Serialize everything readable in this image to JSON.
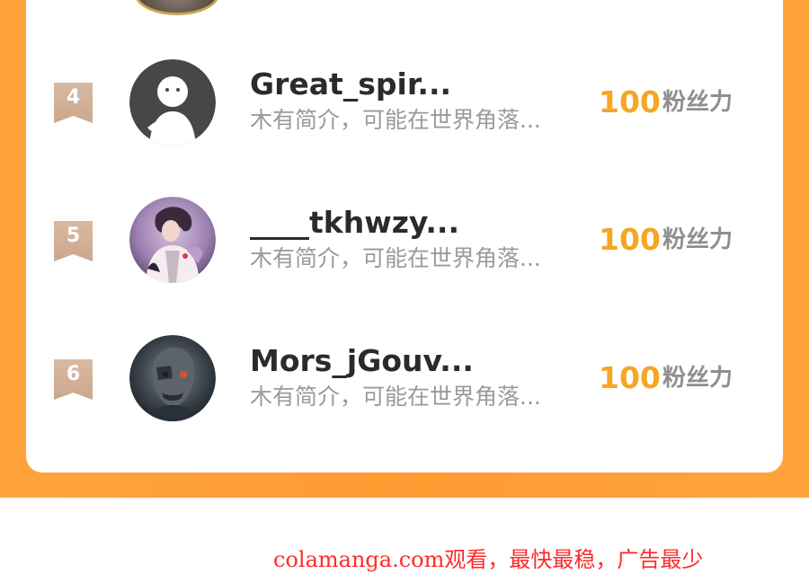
{
  "accent_color": "#ffa43a",
  "score_color": "#f5a623",
  "watermark_color": "#ff2a2a",
  "ranking": [
    {
      "rank": "4",
      "name": "Great_spir...",
      "bio": "木有简介，可能在世界角落...",
      "score": "100",
      "unit": "粉丝力",
      "avatar_icon": "default-ghost-avatar"
    },
    {
      "rank": "5",
      "name": "____tkhwzy...",
      "bio": "木有简介，可能在世界角落...",
      "score": "100",
      "unit": "粉丝力",
      "avatar_icon": "anime-characters-avatar"
    },
    {
      "rank": "6",
      "name": "Mors_jGouv...",
      "bio": "木有简介，可能在世界角落...",
      "score": "100",
      "unit": "粉丝力",
      "avatar_icon": "cyborg-face-avatar"
    }
  ],
  "watermark": "colamanga.com观看，最快最稳，广告最少"
}
